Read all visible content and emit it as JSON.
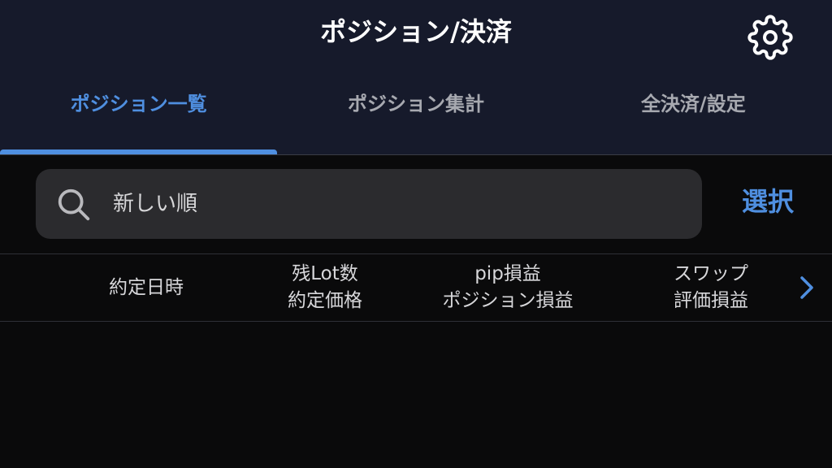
{
  "header": {
    "title": "ポジション/決済",
    "settings_icon": "gear-icon"
  },
  "tabs": [
    {
      "label": "ポジション一覧",
      "active": true
    },
    {
      "label": "ポジション集計",
      "active": false
    },
    {
      "label": "全決済/設定",
      "active": false
    }
  ],
  "search": {
    "icon": "search-icon",
    "value": "新しい順"
  },
  "select_button": {
    "label": "選択"
  },
  "columns": [
    {
      "line1": "約定日時",
      "line2": ""
    },
    {
      "line1": "残Lot数",
      "line2": "約定価格"
    },
    {
      "line1": "pip損益",
      "line2": "ポジション損益"
    },
    {
      "line1": "スワップ",
      "line2": "評価損益"
    }
  ],
  "colors": {
    "accent": "#4f8fe0",
    "header_bg": "#161a2b",
    "body_bg": "#0a0a0b",
    "search_bg": "#2b2b2e"
  }
}
